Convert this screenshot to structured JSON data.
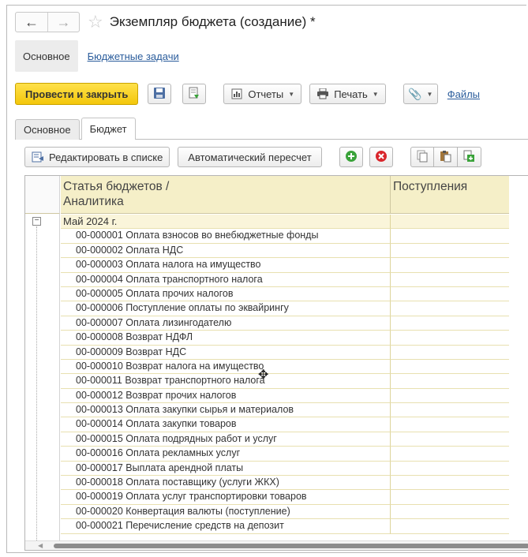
{
  "window": {
    "title": "Экземпляр бюджета (создание) *",
    "back_label": "←",
    "forward_label": "→",
    "favorite_icon": "star-icon"
  },
  "sections": {
    "main_label": "Основное",
    "tasks_link": "Бюджетные задачи"
  },
  "toolbar": {
    "post_close_label": "Провести и закрыть",
    "reports_label": "Отчеты",
    "print_label": "Печать",
    "files_link": "Файлы"
  },
  "tabs": [
    {
      "label": "Основное",
      "active": false
    },
    {
      "label": "Бюджет",
      "active": true
    }
  ],
  "table_toolbar": {
    "edit_in_list_label": "Редактировать в списке",
    "auto_recalc_label": "Автоматический пересчет"
  },
  "grid": {
    "columns": [
      "Статья бюджетов /\nАналитика",
      "Поступления"
    ],
    "column1_line1": "Статья бюджетов /",
    "column1_line2": "Аналитика",
    "column2": "Поступления",
    "group_label": "Май 2024 г.",
    "rows": [
      "00-000001 Оплата взносов во внебюджетные фонды",
      "00-000002 Оплата НДС",
      "00-000003 Оплата налога на имущество",
      "00-000004 Оплата транспортного налога",
      "00-000005 Оплата прочих налогов",
      "00-000006 Поступление оплаты по эквайрингу",
      "00-000007 Оплата лизингодателю",
      "00-000008 Возврат НДФЛ",
      "00-000009 Возврат НДС",
      "00-000010 Возврат налога на имущество",
      "00-000011 Возврат транспортного налога",
      "00-000012 Возврат прочих налогов",
      "00-000013 Оплата закупки сырья и материалов",
      "00-000014 Оплата закупки товаров",
      "00-000015 Оплата подрядных работ и услуг",
      "00-000016 Оплата рекламных услуг",
      "00-000017 Выплата арендной платы",
      "00-000018 Оплата поставщику (услуги ЖКХ)",
      "00-000019 Оплата услуг транспортировки товаров",
      "00-000020 Конвертация валюты (поступление)",
      "00-000021 Перечисление средств на депозит"
    ]
  }
}
